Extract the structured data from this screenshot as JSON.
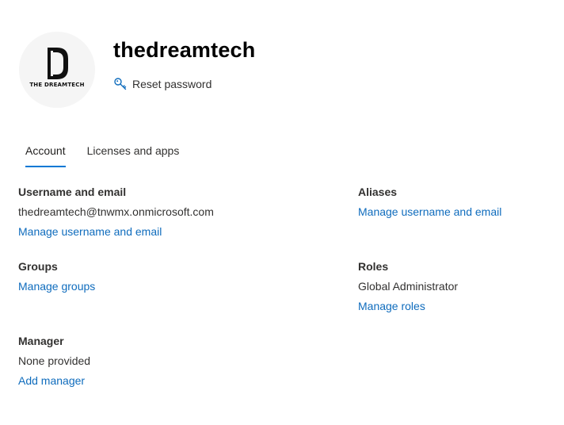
{
  "user": {
    "display_name": "thedreamtech",
    "logo_text": "THE DREAMTECH",
    "logo_letter": "D"
  },
  "actions": {
    "reset_password_label": "Reset password"
  },
  "tabs": [
    {
      "label": "Account",
      "active": true
    },
    {
      "label": "Licenses and apps",
      "active": false
    }
  ],
  "account": {
    "username": {
      "title": "Username and email",
      "value": "thedreamtech@tnwmx.onmicrosoft.com",
      "link": "Manage username and email"
    },
    "aliases": {
      "title": "Aliases",
      "link": "Manage username and email"
    },
    "groups": {
      "title": "Groups",
      "link": "Manage groups"
    },
    "roles": {
      "title": "Roles",
      "value": "Global Administrator",
      "link": "Manage roles"
    },
    "manager": {
      "title": "Manager",
      "value": "None provided",
      "link": "Add manager"
    }
  },
  "colors": {
    "accent": "#0078d4",
    "link": "#0f6cbd",
    "text": "#323130"
  }
}
